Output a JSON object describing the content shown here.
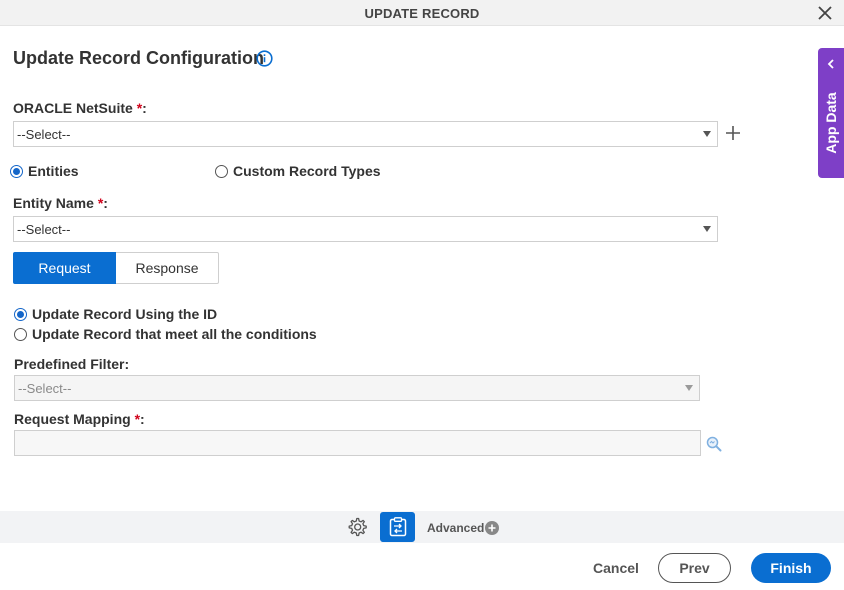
{
  "window": {
    "title": "UPDATE RECORD"
  },
  "page": {
    "heading": "Update Record Configuration"
  },
  "connection": {
    "label": "ORACLE NetSuite",
    "required_mark": "*",
    "colon": ":",
    "selected": "--Select--"
  },
  "record_type": {
    "options": [
      {
        "label": "Entities",
        "checked": true
      },
      {
        "label": "Custom Record Types",
        "checked": false
      }
    ]
  },
  "entity": {
    "label": "Entity Name",
    "required_mark": "*",
    "colon": ":",
    "selected": "--Select--"
  },
  "tabs": [
    {
      "label": "Request",
      "active": true
    },
    {
      "label": "Response",
      "active": false
    }
  ],
  "update_mode": {
    "options": [
      {
        "label": "Update Record Using the ID",
        "checked": true
      },
      {
        "label": "Update Record that meet all the conditions",
        "checked": false
      }
    ]
  },
  "predefined_filter": {
    "label": "Predefined Filter:",
    "selected": "--Select--"
  },
  "request_mapping": {
    "label": "Request Mapping",
    "required_mark": "*",
    "colon": ":",
    "value": ""
  },
  "side_panel": {
    "label": "App Data"
  },
  "advanced": {
    "label": "Advanced"
  },
  "footer": {
    "cancel": "Cancel",
    "prev": "Prev",
    "finish": "Finish"
  },
  "colors": {
    "primary": "#0a6ed1",
    "app_data_tab": "#7e3fc7",
    "required": "#d0021b"
  },
  "icons": [
    "close-icon",
    "info-icon",
    "plus-icon",
    "chevron-left-icon",
    "search-mapping-icon",
    "gear-icon",
    "clipboard-map-icon",
    "plus-circle-icon"
  ]
}
